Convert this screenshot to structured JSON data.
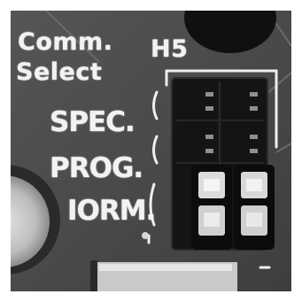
{
  "board": {
    "label_line1": "Comm.",
    "label_line2": "Select",
    "header_ref": "H5",
    "positions": [
      "SPEC.",
      "PROG.",
      "IORM."
    ]
  },
  "colors": {
    "pcb": "#4a4a4a",
    "silkscreen": "#f2f2f2",
    "header_body": "#141414",
    "shunt": "#d8d8d8",
    "frame": "#ffffff"
  }
}
